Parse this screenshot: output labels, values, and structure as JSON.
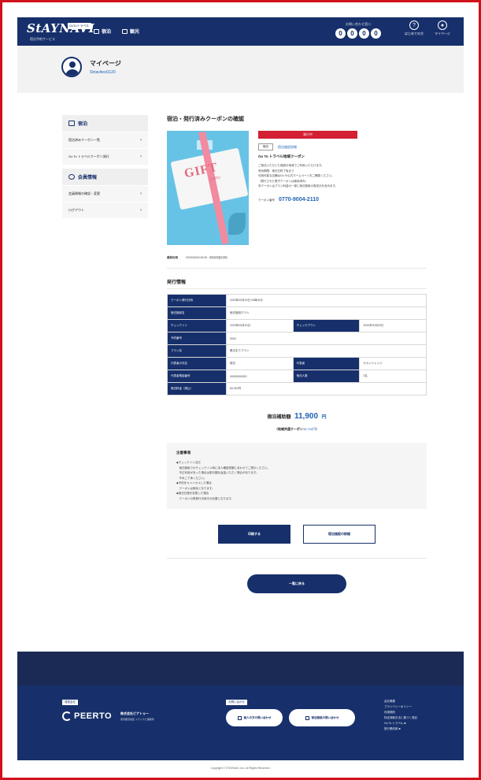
{
  "header": {
    "logo_text": "StAYNAVI",
    "logo_badge": "GoToトラベル",
    "logo_sub": "宿泊予約サービス",
    "nav": [
      {
        "label": "宿泊",
        "icon": "bed-icon"
      },
      {
        "label": "観光",
        "icon": "map-icon"
      }
    ],
    "phone_label": "お問い合わせ窓口",
    "phone_digits": [
      "0",
      "0",
      "0",
      "0"
    ],
    "help_label": "はじめての方",
    "mypage_label": "マイページ"
  },
  "profile": {
    "title": "マイページ",
    "username": "Stnavitest1120"
  },
  "sidebar": {
    "groups": [
      {
        "heading": "宿泊",
        "items": [
          "宿泊済みクーポン一覧",
          "Go To トラベルクーポン発行"
        ]
      },
      {
        "heading": "会員情報",
        "items": [
          "会員情報の確認・変更",
          "ログアウト"
        ]
      }
    ]
  },
  "main": {
    "page_title": "宿泊・発行済みクーポンの確認",
    "status_bar": "発行中",
    "tag": "宿泊",
    "tag_link": "宿泊施設詳細",
    "coupon_name": "Go To トラベル地域クーポン",
    "coupon_lines": [
      "ご宿泊いただいた施設の地域でご利用いただけます。",
      "有効期限：宿泊日終了後まで",
      "利用可能な店舗はGo To公式ホームページをご確認ください。",
      "（発行された電子クーポンは使用済み）",
      "本クーポンはプラン料金の一部に宿泊施設の負担分を含みます。"
    ],
    "coupon_code_label": "クーポン番号",
    "coupon_code": "0770-9004-2110",
    "usage_label": "最新利用",
    "usage_value": "2020/00/00 00:00（利用可能日時）",
    "gift_word": "GIFT",
    "gift_sub": "CARD",
    "section_title": "発行情報",
    "table": {
      "rows": [
        [
          {
            "h": "クーポン発行日時"
          },
          {
            "v": "2020年00月00日 00時00分"
          }
        ],
        [
          {
            "h": "宿泊施設名"
          },
          {
            "v": "宿泊施設ホテル"
          }
        ],
        [
          {
            "h": "チェックイン"
          },
          {
            "v": "2020年00月00日"
          },
          {
            "h": "チェックアウト"
          },
          {
            "v": "2020年00月00日"
          }
        ],
        [
          {
            "h": "予約番号"
          },
          {
            "v": "0000"
          }
        ],
        [
          {
            "h": "プラン名"
          },
          {
            "v": "素泊まりプラン"
          }
        ],
        [
          {
            "h": "代表者の氏名"
          },
          {
            "v": "宿泊"
          },
          {
            "h": "代表者"
          },
          {
            "v": "セカンドレンジ"
          }
        ],
        [
          {
            "h": "代表者電話番号"
          },
          {
            "v": "09000000000"
          },
          {
            "h": "宿泊人数"
          },
          {
            "v": "2名"
          }
        ],
        [
          {
            "h": "宿泊料金（税込）"
          },
          {
            "v": "60,000円"
          }
        ]
      ]
    },
    "subsidy_label": "宿泊補助額",
    "subsidy_amount": "11,900",
    "subsidy_unit": "円",
    "subsidy_sub_prefix": "（地域共通クーポン",
    "subsidy_sub_amount": "35,700円",
    "subsidy_sub_suffix": "）",
    "notice_title": "注意事項",
    "notice_lines": [
      "◆チェックイン当日",
      "　宿泊施設でのチェックイン時に本人確認書類とあわせてご提示ください。",
      "　不正利用があった場合は割引額を返金いただく場合があります。",
      "　予めご了承ください。",
      "◆予約をキャンセルした場合",
      "　クーポンは無効となります。",
      "◆宿泊日程を変更した場合",
      "　クーポンの再発行手続きが必要となります。"
    ],
    "btn_primary": "印刷する",
    "btn_outline": "宿泊施設の詳細",
    "back_button": "一覧に戻る"
  },
  "footer": {
    "operator_label": "運営会社",
    "brand": "PEERTO",
    "corp_name": "株式会社ピアトゥー",
    "corp_sub": "東京都渋谷区 ステイナビ事務局",
    "inquiry_label": "お問い合わせ",
    "btn_individual": "個人の方の問い合わせ",
    "btn_business": "宿泊施設の問い合わせ",
    "links": [
      "会社概要",
      "プライバシーポリシー",
      "利用規約",
      "特定商取引法に基づく表記",
      "Go To トラベル ■",
      "旅行業約款 ■"
    ],
    "copyright": "Copyright © STAYNAVI, Inc. All Rights Reserved."
  }
}
